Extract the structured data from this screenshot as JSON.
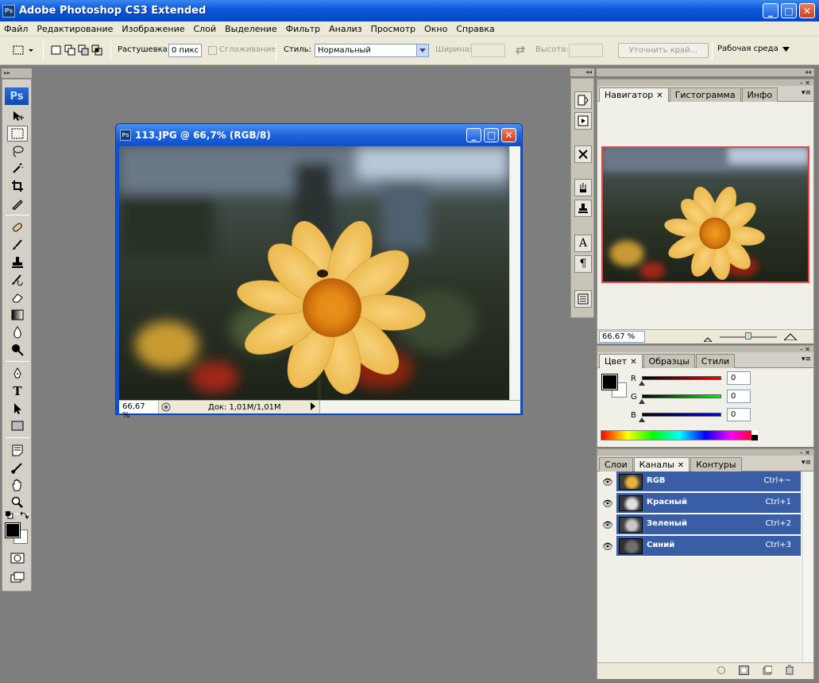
{
  "app": {
    "title": "Adobe Photoshop CS3 Extended",
    "icon_text": "Ps",
    "window_buttons": {
      "minimize": "_",
      "maximize": "□",
      "close": "✕"
    }
  },
  "menu": [
    "Файл",
    "Редактирование",
    "Изображение",
    "Слой",
    "Выделение",
    "Фильтр",
    "Анализ",
    "Просмотр",
    "Окно",
    "Справка"
  ],
  "options_bar": {
    "feather_label": "Растушевка:",
    "feather_value": "0 пикс",
    "antialias_label": "Сглаживание",
    "style_label": "Стиль:",
    "style_value": "Нормальный",
    "width_label": "Ширина:",
    "height_label": "Высота:",
    "refine_edge_label": "Уточнить край...",
    "workspace_label": "Рабочая среда"
  },
  "toolbox": {
    "logo_text": "Ps",
    "tools": [
      "move-tool",
      "marquee-tool",
      "lasso-tool",
      "magic-wand-tool",
      "crop-tool",
      "slice-tool",
      "healing-brush-tool",
      "brush-tool",
      "clone-stamp-tool",
      "history-brush-tool",
      "eraser-tool",
      "gradient-tool",
      "blur-tool",
      "dodge-tool",
      "pen-tool",
      "type-tool",
      "path-selection-tool",
      "shape-tool",
      "notes-tool",
      "eyedropper-tool",
      "hand-tool",
      "zoom-tool"
    ],
    "type_glyph": "T"
  },
  "document": {
    "title": "113.JPG @ 66,7% (RGB/8)",
    "zoom": "66,67 %",
    "doc_info": "Док: 1,01M/1,01M",
    "icon_text": "Ps"
  },
  "navigator_panel": {
    "tabs": [
      {
        "label": "Навигатор",
        "close": "✕"
      },
      {
        "label": "Гистограмма"
      },
      {
        "label": "Инфо"
      }
    ],
    "zoom": "66.67 %",
    "zoom_slider": 0.5
  },
  "color_panel": {
    "tabs": [
      {
        "label": "Цвет",
        "close": "✕"
      },
      {
        "label": "Образцы"
      },
      {
        "label": "Стили"
      }
    ],
    "channels": [
      {
        "label": "R",
        "value": "0"
      },
      {
        "label": "G",
        "value": "0"
      },
      {
        "label": "B",
        "value": "0"
      }
    ],
    "foreground": "#000000",
    "background": "#ffffff"
  },
  "channels_panel": {
    "tabs": [
      {
        "label": "Слои"
      },
      {
        "label": "Каналы",
        "close": "✕"
      },
      {
        "label": "Контуры"
      }
    ],
    "rows": [
      {
        "name": "RGB",
        "shortcut": "Ctrl+~"
      },
      {
        "name": "Красный",
        "shortcut": "Ctrl+1"
      },
      {
        "name": "Зеленый",
        "shortcut": "Ctrl+2"
      },
      {
        "name": "Синий",
        "shortcut": "Ctrl+3"
      }
    ]
  },
  "colors": {
    "titlebar": "#0a58d8",
    "workspace": "#7e7e7e",
    "selection": "#3a5ea6"
  }
}
